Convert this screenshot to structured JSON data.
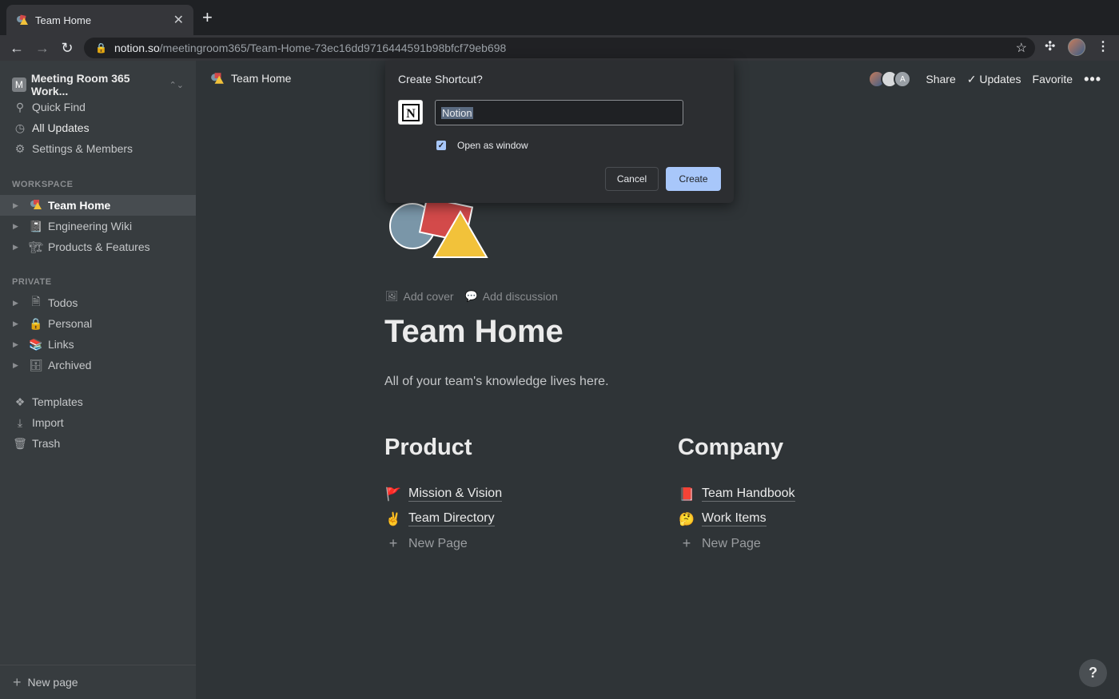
{
  "browser": {
    "tab_title": "Team Home",
    "url_host": "notion.so",
    "url_path": "/meetingroom365/Team-Home-73ec16dd9716444591b98bfcf79eb698"
  },
  "sidebar": {
    "workspace_initial": "M",
    "workspace_name": "Meeting Room 365 Work...",
    "top_items": [
      {
        "label": "Quick Find",
        "icon": "search-icon"
      },
      {
        "label": "All Updates",
        "icon": "clock-icon"
      },
      {
        "label": "Settings & Members",
        "icon": "gear-icon"
      }
    ],
    "workspace_label": "WORKSPACE",
    "workspace_pages": [
      {
        "label": "Team Home",
        "icon": "shapes-icon"
      },
      {
        "label": "Engineering Wiki",
        "icon": "notebook-icon"
      },
      {
        "label": "Products & Features",
        "icon": "crane-icon"
      }
    ],
    "private_label": "PRIVATE",
    "private_pages": [
      {
        "label": "Todos",
        "icon": "document-icon"
      },
      {
        "label": "Personal",
        "icon": "lock-icon"
      },
      {
        "label": "Links",
        "icon": "books-icon"
      },
      {
        "label": "Archived",
        "icon": "cabinet-icon"
      }
    ],
    "bottom_items": [
      {
        "label": "Templates",
        "icon": "templates-icon"
      },
      {
        "label": "Import",
        "icon": "download-icon"
      },
      {
        "label": "Trash",
        "icon": "trash-icon"
      }
    ],
    "new_page": "New page"
  },
  "topbar": {
    "breadcrumb": "Team Home",
    "share": "Share",
    "updates": "Updates",
    "favorite": "Favorite",
    "avatar_letter": "A"
  },
  "dialog": {
    "title": "Create Shortcut?",
    "name_value": "Notion",
    "checkbox_label": "Open as window",
    "checkbox_checked": true,
    "cancel": "Cancel",
    "create": "Create"
  },
  "page": {
    "add_cover": "Add cover",
    "add_discussion": "Add discussion",
    "title": "Team Home",
    "description": "All of your team's knowledge lives here.",
    "columns": [
      {
        "heading": "Product",
        "links": [
          {
            "emoji": "🚩",
            "label": "Mission & Vision"
          },
          {
            "emoji": "✌️",
            "label": "Team Directory"
          }
        ],
        "new_page": "New Page"
      },
      {
        "heading": "Company",
        "links": [
          {
            "emoji": "📕",
            "label": "Team Handbook"
          },
          {
            "emoji": "🤔",
            "label": "Work Items"
          }
        ],
        "new_page": "New Page"
      }
    ],
    "help": "?"
  },
  "colors": {
    "sidebar_bg": "#373c3f",
    "page_bg": "#2f3437",
    "accent_button": "#a8c7fa"
  }
}
